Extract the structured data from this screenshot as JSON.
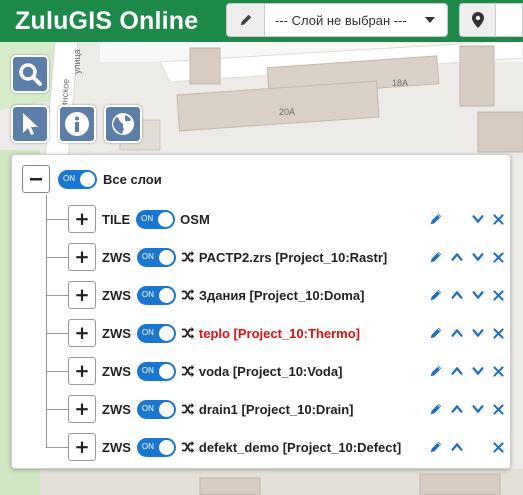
{
  "header": {
    "brand": "ZuluGIS Online",
    "layer_select_value": "--- Слой не выбран ---"
  },
  "map": {
    "labels": {
      "street1": "улица",
      "street2": "Нутинское",
      "building_18a": "18А",
      "building_20a": "20А"
    }
  },
  "colors": {
    "header": "#1d8a4a",
    "toggle": "#1977d2",
    "icon_blue": "#1e6fc0",
    "error_red": "#e01010",
    "tool_button": "#5b7faa"
  },
  "tools": [
    {
      "name": "search-icon"
    },
    {
      "name": "cursor-icon"
    },
    {
      "name": "info-icon"
    },
    {
      "name": "globe-icon"
    }
  ],
  "panel": {
    "root": {
      "label": "Все слои",
      "toggle": "ON"
    },
    "layers": [
      {
        "type": "TILE",
        "toggle": "ON",
        "name": "OSM",
        "shuffle": false,
        "red": false,
        "up": false,
        "down": true
      },
      {
        "type": "ZWS",
        "toggle": "ON",
        "name": "PACTP2.zrs [Project_10:Rastr]",
        "shuffle": true,
        "red": false,
        "up": true,
        "down": true
      },
      {
        "type": "ZWS",
        "toggle": "ON",
        "name": "Здания [Project_10:Doma]",
        "shuffle": true,
        "red": false,
        "up": true,
        "down": true
      },
      {
        "type": "ZWS",
        "toggle": "ON",
        "name": "teplo [Project_10:Thermo]",
        "shuffle": true,
        "red": true,
        "up": true,
        "down": true
      },
      {
        "type": "ZWS",
        "toggle": "ON",
        "name": "voda [Project_10:Voda]",
        "shuffle": true,
        "red": false,
        "up": true,
        "down": true
      },
      {
        "type": "ZWS",
        "toggle": "ON",
        "name": "drain1 [Project_10:Drain]",
        "shuffle": true,
        "red": false,
        "up": true,
        "down": true
      },
      {
        "type": "ZWS",
        "toggle": "ON",
        "name": "defekt_demo [Project_10:Defect]",
        "shuffle": true,
        "red": false,
        "up": true,
        "down": false
      }
    ]
  }
}
